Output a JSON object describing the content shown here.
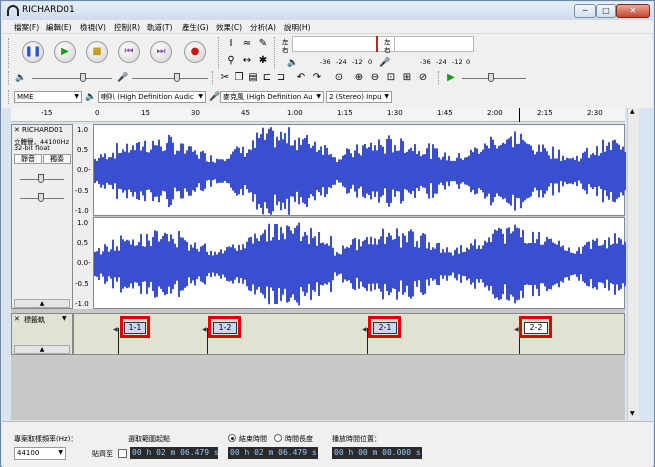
{
  "window": {
    "title": "RICHARD01",
    "min": "─",
    "max": "□",
    "close": "✕"
  },
  "menus": [
    "檔案(F)",
    "編輯(E)",
    "檢視(V)",
    "控制(R)",
    "軌道(T)",
    "產生(G)",
    "效果(C)",
    "分析(A)",
    "說明(H)"
  ],
  "meters": {
    "left": "左",
    "right": "右",
    "ticks": [
      "-36",
      "-24",
      "-12",
      "0"
    ]
  },
  "devices": {
    "host": "MME",
    "output": "喇叭 (High Definition Audic",
    "input": "麥克風 (High Definition Au",
    "channels": "2 (Stereo) Inpu"
  },
  "ruler": [
    "-15",
    "0",
    "15",
    "30",
    "45",
    "1:00",
    "1:15",
    "1:30",
    "1:45",
    "2:00",
    "2:15",
    "2:30"
  ],
  "audio_track": {
    "name": "RICHARD01",
    "info1": "立體聲，44100Hz",
    "info2": "32-bit float",
    "mute": "靜音",
    "solo": "獨奏",
    "yscale": [
      "1.0",
      "0.5",
      "0.0-",
      "-0.5",
      "-1.0"
    ]
  },
  "label_track": {
    "name": "標籤軌",
    "labels": [
      "1-1",
      "1-2",
      "2-1",
      "2-2"
    ]
  },
  "bottom": {
    "rate_label": "專案取樣頻率(Hz)：",
    "rate": "44100",
    "snap": "貼齊至",
    "sel_label": "選取範圍起點",
    "end_label": "結束時間",
    "len_label": "時間長度",
    "pos_label": "播放時間位置：",
    "t1": "00 h 02 m 06.479 s",
    "t2": "00 h 02 m 06.479 s",
    "t3": "00 h 00 m 00.000 s"
  }
}
